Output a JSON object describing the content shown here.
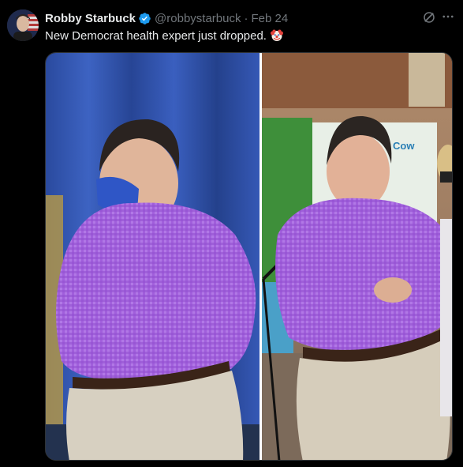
{
  "post": {
    "author": {
      "display_name": "Robby Starbuck",
      "verified": true,
      "handle": "@robbystarbuck",
      "avatar_icon": "avatar-photo"
    },
    "separator": "·",
    "date": "Feb 24",
    "text": "New Democrat health expert just dropped.",
    "emoji": "clown-face",
    "media": {
      "description_icon": "photo-comparison",
      "panels": [
        "left-photo",
        "right-photo"
      ]
    },
    "actions": {
      "grok_icon": "grok-icon",
      "more_icon": "more-icon"
    }
  },
  "colors": {
    "background": "#000000",
    "primary_text": "#e7e9ea",
    "secondary_text": "#71767b",
    "verified_blue": "#1d9bf0",
    "shirt_purple": "#9a57d6",
    "curtain_blue": "#2c50a8"
  }
}
